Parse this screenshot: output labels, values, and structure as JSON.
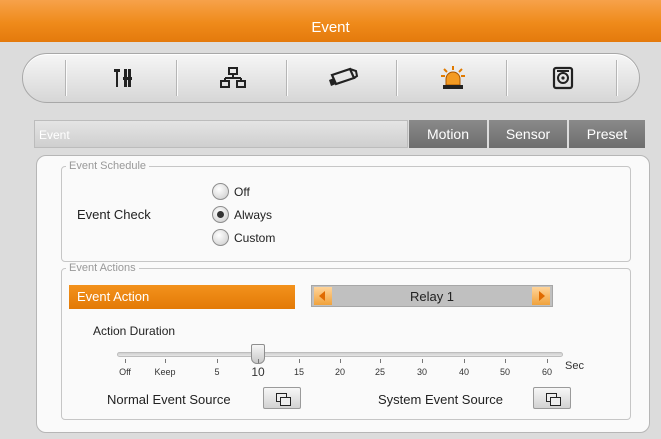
{
  "header": {
    "title": "Event"
  },
  "toolbar": {
    "icons": [
      "tools-icon",
      "network-icon",
      "camera-icon",
      "alarm-light-icon",
      "storage-icon"
    ]
  },
  "tabs": {
    "header_label": "Event",
    "items": [
      "Motion",
      "Sensor",
      "Preset"
    ]
  },
  "schedule": {
    "legend": "Event Schedule",
    "event_check_label": "Event Check",
    "options": [
      "Off",
      "Always",
      "Custom"
    ],
    "selected": "Always"
  },
  "actions": {
    "legend": "Event Actions",
    "event_action_label": "Event Action",
    "relay_value": "Relay 1",
    "duration_label": "Action Duration",
    "duration_ticks": [
      "Off",
      "Keep",
      "5",
      "10",
      "15",
      "20",
      "25",
      "30",
      "40",
      "50",
      "60"
    ],
    "duration_value": "10",
    "unit": "Sec",
    "normal_source_label": "Normal Event Source",
    "system_source_label": "System Event Source"
  },
  "colors": {
    "accent": "#ef8a1a",
    "tab": "#7a7a7a"
  }
}
